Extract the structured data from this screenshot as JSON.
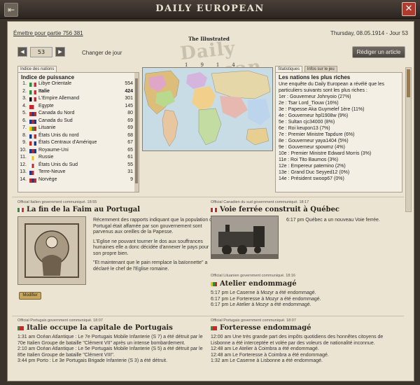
{
  "window": {
    "title": "DAILY EUROPEAN",
    "close_glyph": "✕",
    "pin_glyph": "⇤"
  },
  "header": {
    "issue_link": "Émettre pour partie 756 381",
    "date": "Thursday, 08.05.1914 - Jour 53",
    "masthead_small": "The Illustrated",
    "masthead_big": "Daily European",
    "masthead_year_left": "19",
    "masthead_year_right": "14"
  },
  "turn": {
    "prev": "◀",
    "value": "53",
    "next": "▶",
    "change_label": "Changer de jour"
  },
  "write_button": "Rédiger un article",
  "power_index": {
    "tab": "Indice des nations",
    "title": "Indice de puissance",
    "rows": [
      {
        "rank": "1.",
        "name": "Libye Orientale",
        "score": "554",
        "flag": [
          "#2d8f3a",
          "#e8e8e8",
          "#d32f2f"
        ]
      },
      {
        "rank": "2.",
        "name": "Italie",
        "score": "424",
        "flag": [
          "#2d8f3a",
          "#f5f5f5",
          "#d32f2f"
        ],
        "bold": true
      },
      {
        "rank": "3.",
        "name": "L'Empire Allemand",
        "score": "301",
        "flag": [
          "#111111",
          "#f5f5f5",
          "#c62828"
        ]
      },
      {
        "rank": "4.",
        "name": "Egypte",
        "score": "145",
        "flag": [
          "#c62828",
          "#c62828",
          "#f5f5f5"
        ]
      },
      {
        "rank": "5.",
        "name": "Canada du Nord",
        "score": "80",
        "flag": [
          "#c62828",
          "#1a3a8f",
          "#c62828"
        ]
      },
      {
        "rank": "6.",
        "name": "Canada du Sud",
        "score": "69",
        "flag": [
          "#1a3a8f",
          "#c62828",
          "#1a3a8f"
        ]
      },
      {
        "rank": "7.",
        "name": "Lituanie",
        "score": "69",
        "flag": [
          "#f2c200",
          "#2d8f3a",
          "#c62828"
        ]
      },
      {
        "rank": "8.",
        "name": "États Unis du nord",
        "score": "68",
        "flag": [
          "#1a3a8f",
          "#f5f5f5",
          "#c62828"
        ]
      },
      {
        "rank": "9.",
        "name": "États Centraux d'Amérique",
        "score": "67",
        "flag": [
          "#c62828",
          "#f5f5f5",
          "#1a3a8f"
        ]
      },
      {
        "rank": "10.",
        "name": "Royaume-Uni",
        "score": "65",
        "flag": [
          "#1a3a8f",
          "#c62828",
          "#1a3a8f"
        ]
      },
      {
        "rank": "11.",
        "name": "Russie",
        "score": "61",
        "flag": [
          "#f5f5f5",
          "#f2c200",
          "#f5f5f5"
        ]
      },
      {
        "rank": "12.",
        "name": "États Unis du Sud",
        "score": "55",
        "flag": [
          "#f5f5f5",
          "#c62828",
          "#f5f5f5"
        ]
      },
      {
        "rank": "13.",
        "name": "Terre-Neuve",
        "score": "31",
        "flag": [
          "#1a3a8f",
          "#c62828",
          "#f5f5f5"
        ]
      },
      {
        "rank": "14.",
        "name": "Norvège",
        "score": "9",
        "flag": [
          "#c62828",
          "#1a3a8f",
          "#c62828"
        ]
      }
    ]
  },
  "stats": {
    "tab_stats": "Statistiques",
    "tab_info": "Infos sur le jeu",
    "title": "Les nations les plus riches",
    "intro": "Une enquête du Daily European a révélé que les particuliers suivants sont les plus riches :",
    "lines": [
      "1er : Gouverneur Johnyoio (27%)",
      "2e : Tsar Lord_Tiouw (16%)",
      "3e : Papesse Aka Guymelef 1ère (11%)",
      "4e : Gouverneur hpl1908w (9%)",
      "5e : Sultan cjc34000 (8%)",
      "6e : Roi keupon13 (7%)",
      "7e : Premier Ministre Tapdure (6%)",
      "8e : Gouverneur yaya1404 (5%)",
      "9e : Gouverneur spowmz (4%)",
      "10e : Premier Ministre Edward Morris (3%)",
      "11e : Roi Tito Baumos (3%)",
      "12e : Empereur patemino (2%)",
      "13e : Grand Duc Seyyed12 (0%)",
      "14e : Président swoop67 (0%)"
    ]
  },
  "articles": [
    {
      "source": "Official Italien government communiqué. 18:55",
      "headline": "La fin de la Faim au Portugal",
      "flag": [
        "#2d8f3a",
        "#f5f5f5",
        "#d32f2f"
      ],
      "paragraphs": [
        "Récemment des rapports indiquant que la population du Portugal était affamée par son gouvernement sont parvenus aux oreilles de la Papesse.",
        "L'Eglise ne pouvant tourner le dos aux souffrances humaines elle a donc décidée d'annexer le pays pour son propre bien.",
        "\"Et maintenant que le pain remplace la baïonnette\" a déclaré le chef de l'Eglise romaine."
      ],
      "button": "Modifier"
    },
    {
      "source": "Official Canadien du sud government communiqué. 18:17",
      "headline": "Voie ferrée construit à Québec",
      "flag": [
        "#c62828",
        "#f5f5f5",
        "#c62828"
      ],
      "body": "6:17 pm Québec a un nouveau Voie ferrée."
    },
    {
      "source": "Official Lituanien government communiqué. 18:16",
      "headline": "Atelier endommagé",
      "flag": [
        "#f2c200",
        "#2d8f3a",
        "#c62828"
      ],
      "lines": [
        "5:17 pm Le Caserne à Mozyr a été endommagé.",
        "6:17 pm Le Forteresse à Mozyr a été endommagé.",
        "6:17 pm Le Atelier à Mozyr a été endommagé."
      ]
    },
    {
      "source": "Official Portugais government communiqué. 18:07",
      "headline": "Italie occupe la capitale de Portugais",
      "flag": [
        "#2d8f3a",
        "#c62828",
        "#c62828"
      ],
      "lines": [
        "1:31 am Océan Atlantique : Le 7e Portugais Mobile Infanterie (S 7) a été détruit par le 70e Italien Groupe de bataille \"Clément VII\" après un intense bombardement.",
        "2:10 am Océan Atlantique : Le 5e Portugais Mobile Infanterie (S 5) a été détruit par le 85e Italien Groupe de bataille \"Clément VIII\".",
        "3:44 pm Porto : Le 3e Portugais Brigade Infanterie (S 3) a été détruit."
      ]
    },
    {
      "source": "Official Portugais government communiqué. 18:07",
      "headline": "Forteresse endommagé",
      "flag": [
        "#2d8f3a",
        "#c62828",
        "#c62828"
      ],
      "lines": [
        "12:00 am Une très grande part des impôts quotidiens des honnêtes citoyens de Lisbonne a été interceptée et volée par des voleurs de nationalité inconnue.",
        "12:48 am Le Atelier à Coimbra a été endommagé.",
        "12:48 am Le Forteresse à Coimbra a été endommagé.",
        "1:32 am Le Caserne à Lisbonne a été endommagé."
      ]
    }
  ]
}
